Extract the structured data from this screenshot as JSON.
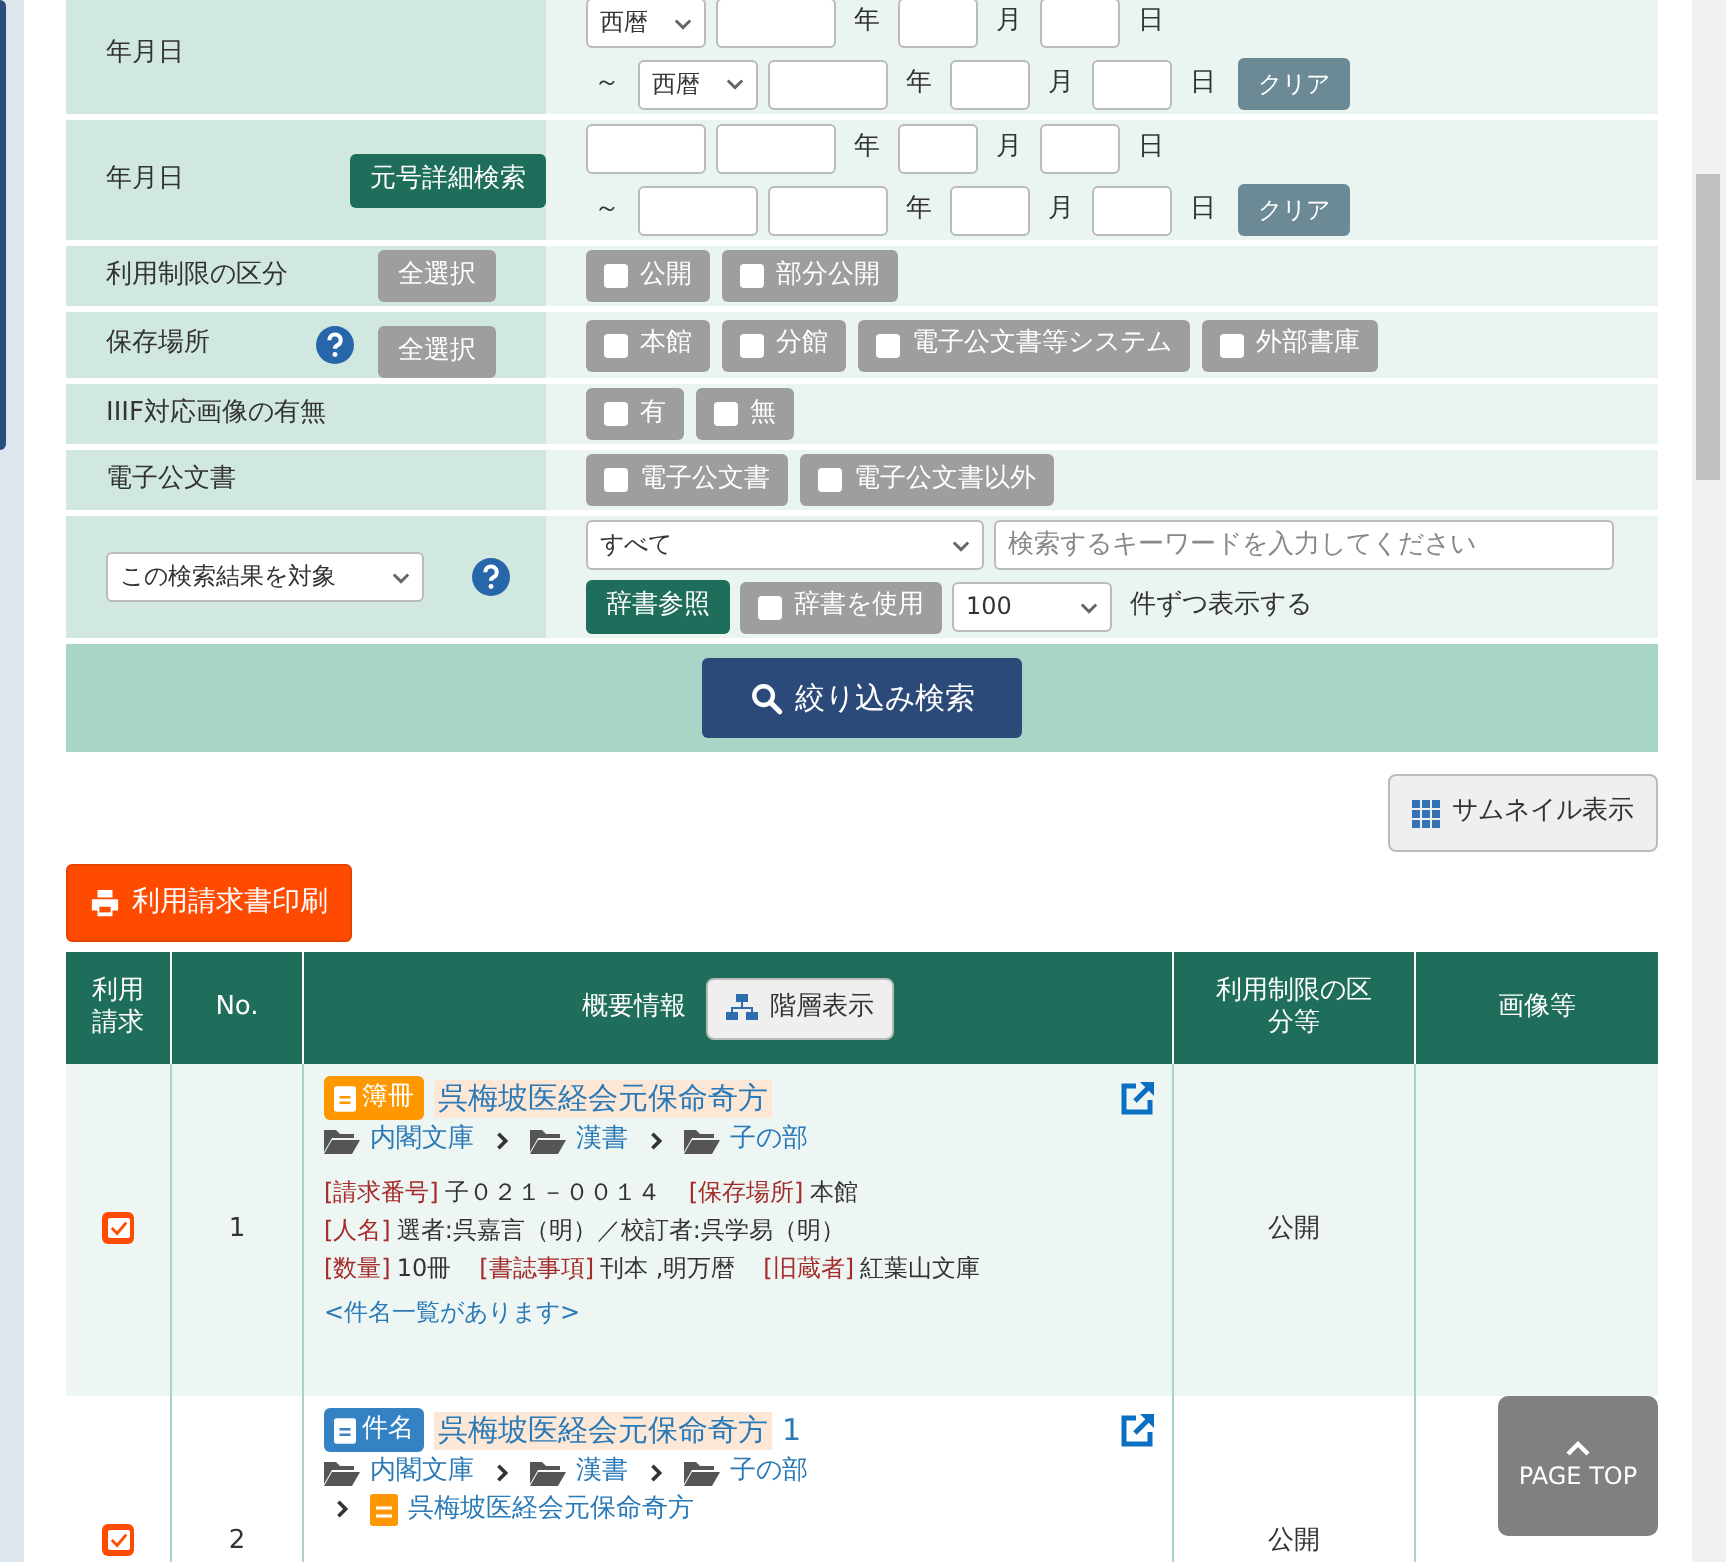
{
  "search_form": {
    "rows": [
      {
        "kind": "date",
        "label": "年月日",
        "lines": [
          {
            "era": "西暦",
            "units": [
              "年",
              "月",
              "日"
            ]
          },
          {
            "prefix": "～",
            "era": "西暦",
            "units": [
              "年",
              "月",
              "日"
            ],
            "clear": "クリア"
          }
        ]
      },
      {
        "kind": "date",
        "label": "年月日",
        "button": "元号詳細検索",
        "lines": [
          {
            "units": [
              "年",
              "月",
              "日"
            ]
          },
          {
            "prefix": "～",
            "units": [
              "年",
              "月",
              "日"
            ],
            "clear": "クリア"
          }
        ]
      },
      {
        "kind": "checkbox",
        "label": "利用制限の区分",
        "help": false,
        "select_all": "全選択",
        "options": [
          {
            "label": "公開",
            "checked": false
          },
          {
            "label": "部分公開",
            "checked": false
          }
        ]
      },
      {
        "kind": "checkbox",
        "label": "保存場所",
        "help": true,
        "select_all": "全選択",
        "options": [
          {
            "label": "本館",
            "checked": false
          },
          {
            "label": "分館",
            "checked": false
          },
          {
            "label": "電子公文書等システム",
            "checked": false
          },
          {
            "label": "外部書庫",
            "checked": false
          }
        ]
      },
      {
        "kind": "checkbox",
        "label": "IIIF対応画像の有無",
        "help": false,
        "options": [
          {
            "label": "有",
            "checked": false
          },
          {
            "label": "無",
            "checked": false
          }
        ]
      },
      {
        "kind": "checkbox",
        "label": "電子公文書",
        "help": false,
        "options": [
          {
            "label": "電子公文書",
            "checked": false
          },
          {
            "label": "電子公文書以外",
            "checked": false
          }
        ]
      },
      {
        "kind": "keyword",
        "scope": "この検索結果を対象",
        "help": true,
        "field": "すべて",
        "placeholder": "検索するキーワードを入力してください",
        "dictionary_button": "辞書参照",
        "use_dictionary": {
          "label": "辞書を使用",
          "checked": false
        },
        "per_page": "100",
        "per_page_suffix": "件ずつ表示する"
      }
    ],
    "submit": "絞り込み検索"
  },
  "thumbnail_button": "サムネイル表示",
  "print_button": "利用請求書印刷",
  "results": {
    "columns": [
      {
        "label": "利用請求"
      },
      {
        "label": "No."
      },
      {
        "label": "概要情報",
        "button": "階層表示"
      },
      {
        "label": "利用制限の区分等"
      },
      {
        "label": "画像等"
      }
    ],
    "rows": [
      {
        "checked": true,
        "no": "1",
        "type": {
          "kind": "volume",
          "label": "簿冊"
        },
        "title": "呉梅坡医経会元保命奇方",
        "title_suffix": null,
        "path": [
          "内閣文庫",
          "漢書",
          "子の部"
        ],
        "parent": null,
        "details": [
          [
            {
              "label": "[請求番号]",
              "value": "子０２１－００１４"
            },
            {
              "label": "[保存場所]",
              "value": "本館"
            }
          ],
          [
            {
              "label": "[人名]",
              "value": "選者:呉嘉言（明）／校訂者:呉学易（明）"
            }
          ],
          [
            {
              "label": "[数量]",
              "value": "10冊"
            },
            {
              "label": "[書誌事項]",
              "value": "刊本 ,明万暦"
            },
            {
              "label": "[旧蔵者]",
              "value": "紅葉山文庫"
            }
          ]
        ],
        "note": "<件名一覧があります>",
        "restriction": "公開"
      },
      {
        "checked": true,
        "no": "2",
        "type": {
          "kind": "item",
          "label": "件名"
        },
        "title": "呉梅坡医経会元保命奇方",
        "title_suffix": "1",
        "path": [
          "内閣文庫",
          "漢書",
          "子の部"
        ],
        "parent": "呉梅坡医経会元保命奇方",
        "details": [],
        "note": null,
        "restriction": "公開"
      }
    ]
  },
  "page_top": "PAGE TOP"
}
